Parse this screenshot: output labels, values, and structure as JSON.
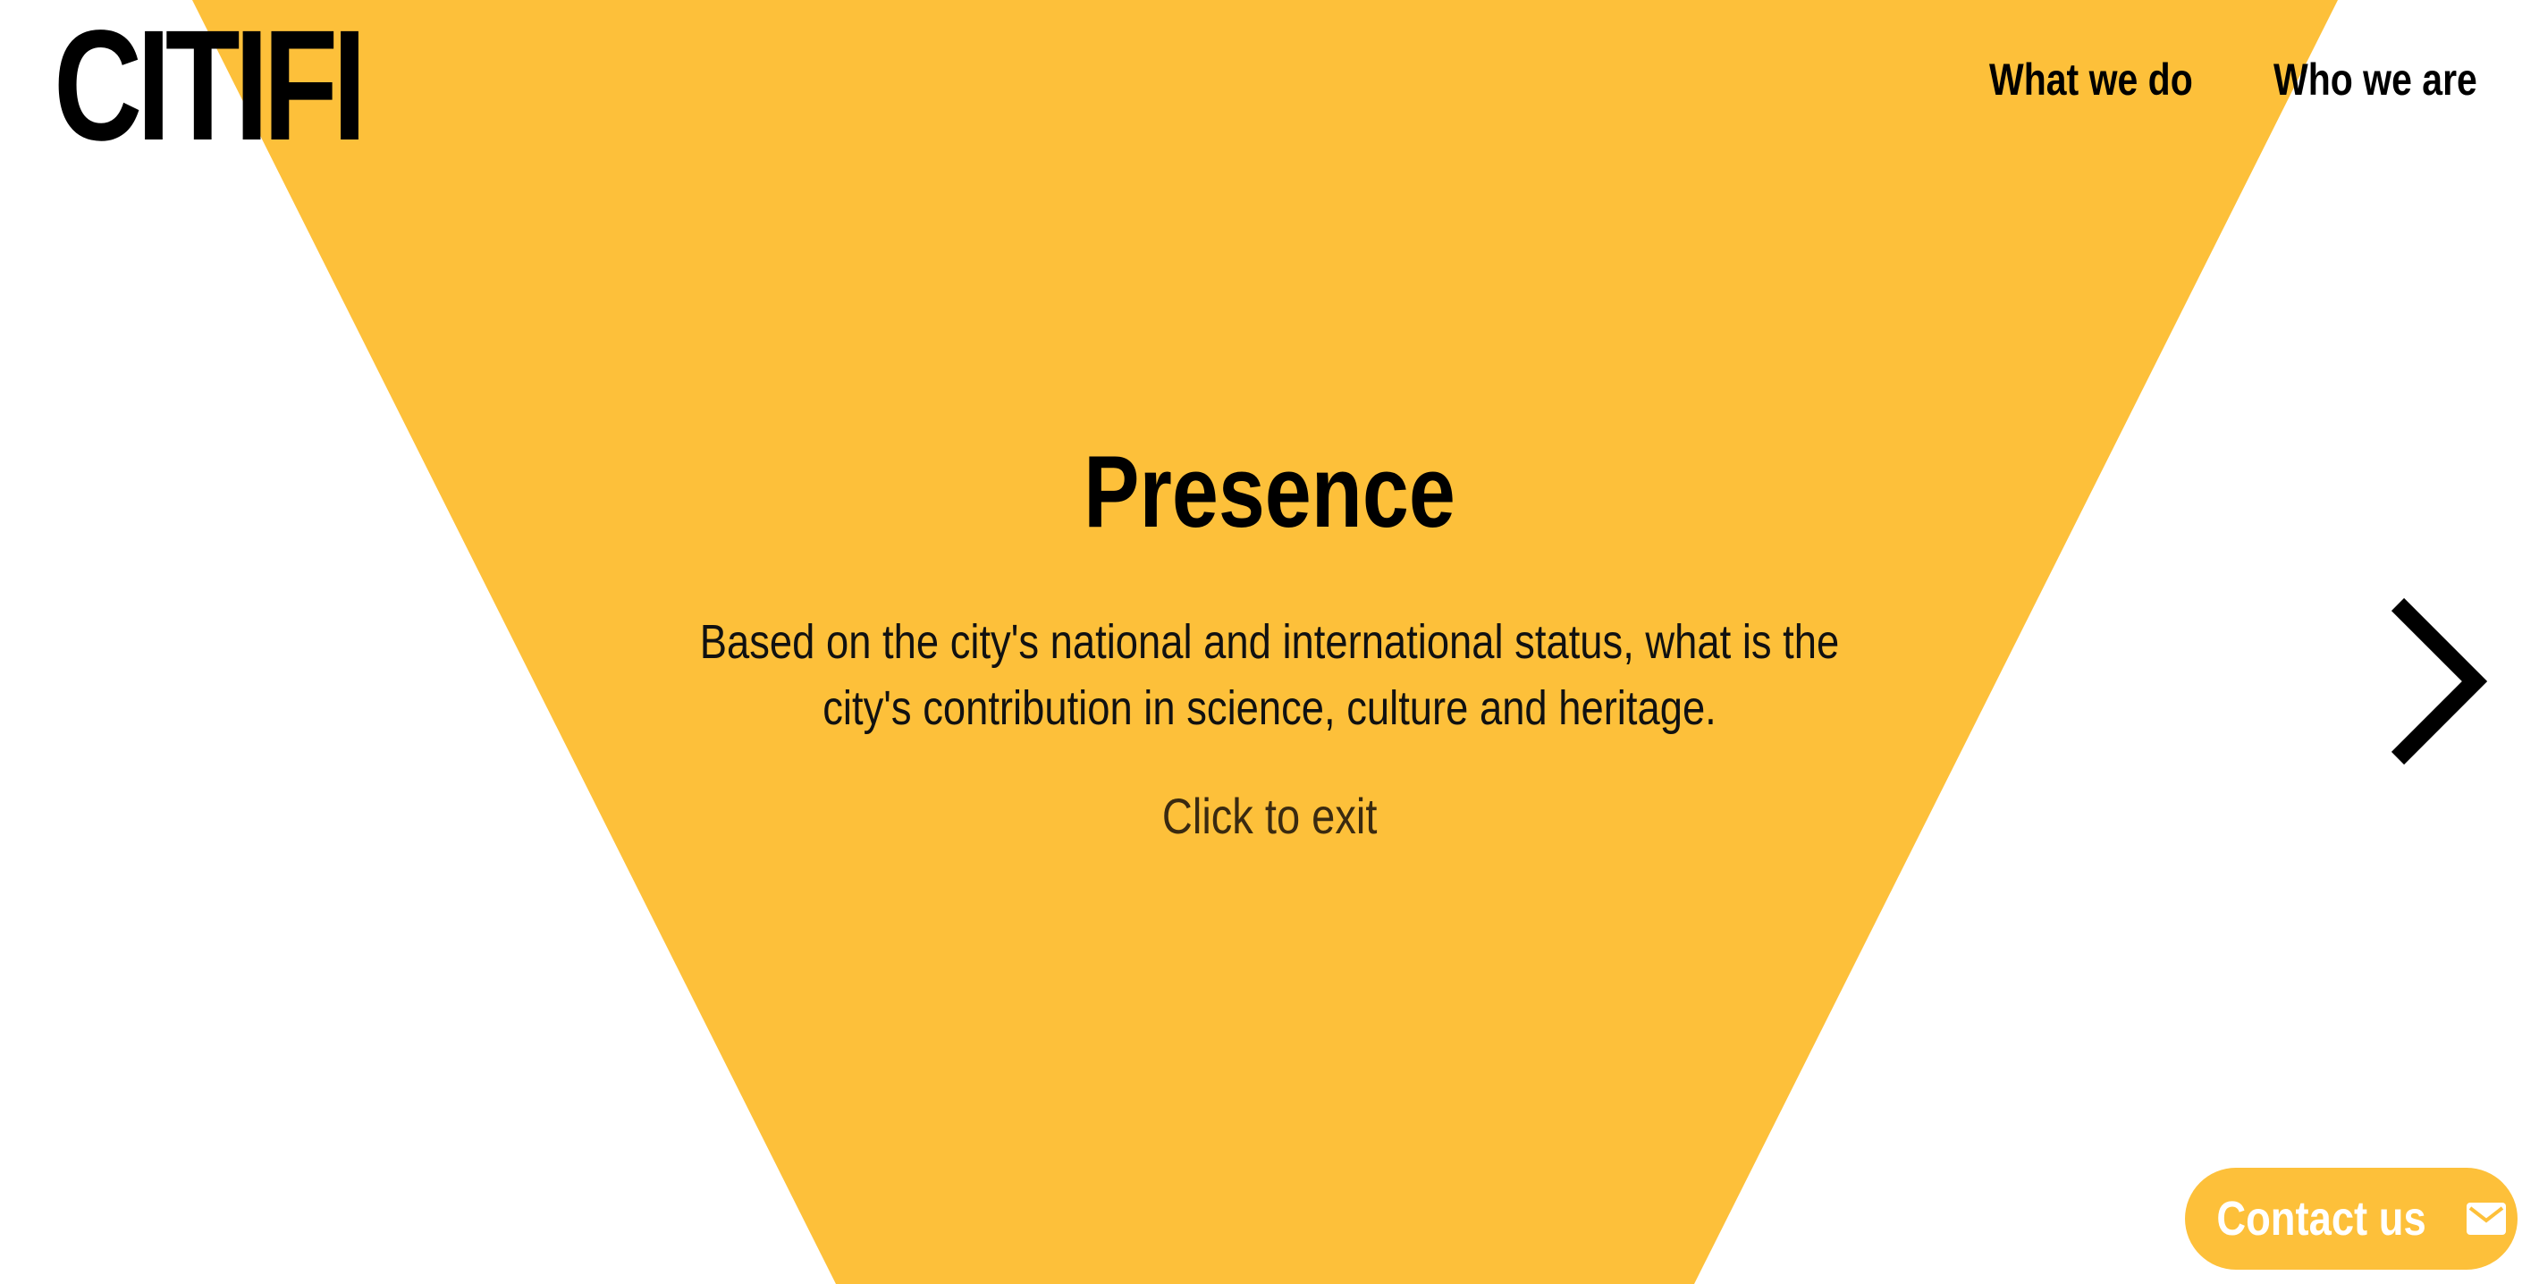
{
  "brand": {
    "logo_text": "CITIFI"
  },
  "nav": {
    "items": [
      {
        "label": "What we do"
      },
      {
        "label": "Who we are"
      }
    ]
  },
  "hero": {
    "title": "Presence",
    "description": "Based on the city's national and international status, what is the city's contribution in science, culture and heritage.",
    "exit_label": "Click to exit"
  },
  "controls": {
    "next_icon": "chevron-right-icon"
  },
  "contact": {
    "label": "Contact us",
    "icon": "mail-icon"
  },
  "colors": {
    "accent": "#fdc03a",
    "text": "#000000",
    "background": "#ffffff"
  }
}
